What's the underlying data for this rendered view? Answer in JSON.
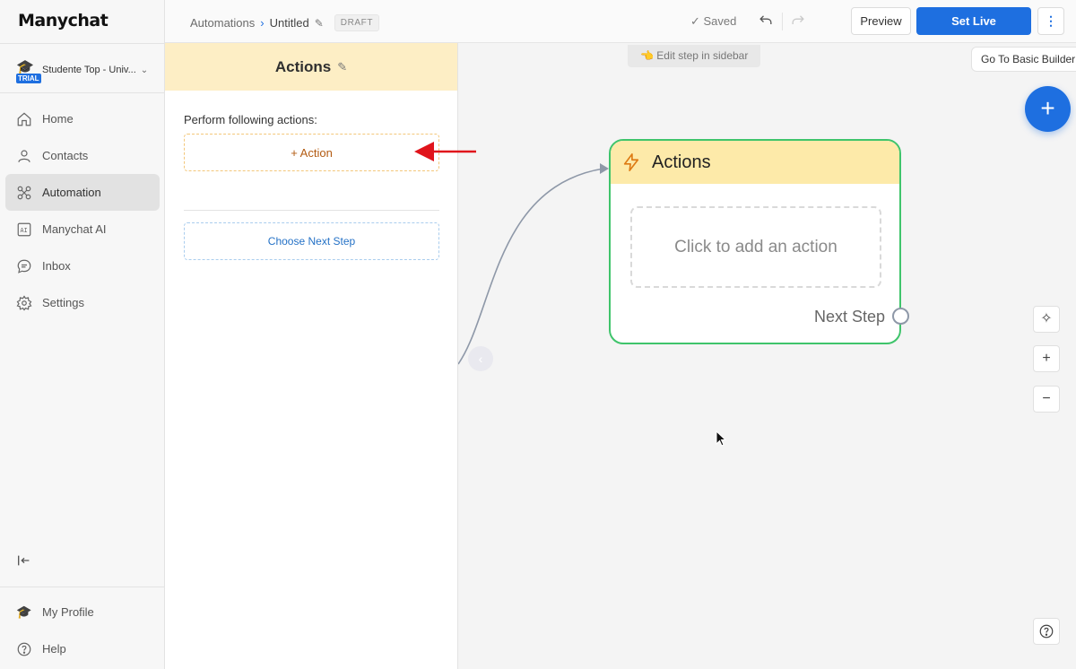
{
  "brand": {
    "logo": "Manychat"
  },
  "account": {
    "name": "Studente Top - Univ...",
    "badge": "TRIAL"
  },
  "nav": {
    "items": [
      {
        "label": "Home",
        "icon": "home-icon"
      },
      {
        "label": "Contacts",
        "icon": "user-icon"
      },
      {
        "label": "Automation",
        "icon": "automation-icon",
        "active": true
      },
      {
        "label": "Manychat AI",
        "icon": "ai-icon"
      },
      {
        "label": "Inbox",
        "icon": "chat-icon"
      },
      {
        "label": "Settings",
        "icon": "gear-icon"
      }
    ],
    "bottom": [
      {
        "label": "My Profile",
        "icon": "avatar-icon"
      },
      {
        "label": "Help",
        "icon": "help-icon"
      }
    ]
  },
  "header": {
    "breadcrumb_root": "Automations",
    "title": "Untitled",
    "status": "DRAFT",
    "saved": "✓ Saved",
    "preview": "Preview",
    "set_live": "Set Live"
  },
  "panel": {
    "title": "Actions",
    "perform_label": "Perform following actions:",
    "add_action": "+ Action",
    "choose_next": "Choose Next Step"
  },
  "canvas": {
    "hint": "👈 Edit step in sidebar",
    "basic_builder": "Go To Basic Builder",
    "node": {
      "title": "Actions",
      "placeholder": "Click to add an action",
      "next_step": "Next Step"
    }
  },
  "colors": {
    "accent": "#1e6fe0",
    "node_border": "#3fc46b",
    "node_header": "#fdeaa9",
    "panel_header": "#fdeec5",
    "annotation_arrow": "#e0141b"
  }
}
